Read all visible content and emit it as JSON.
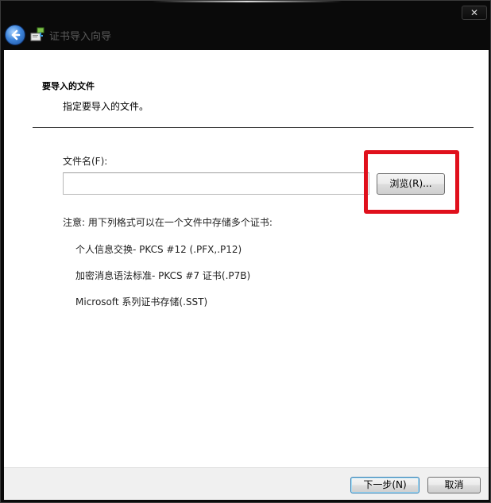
{
  "window": {
    "title": "证书导入向导",
    "close_glyph": "✕"
  },
  "page": {
    "heading": "要导入的文件",
    "subheading": "指定要导入的文件。",
    "file_label": "文件名(F):",
    "file_value": "",
    "browse_label": "浏览(R)...",
    "note": "注意: 用下列格式可以在一个文件中存储多个证书:",
    "formats": [
      "个人信息交换- PKCS #12 (.PFX,.P12)",
      "加密消息语法标准- PKCS #7 证书(.P7B)",
      "Microsoft 系列证书存储(.SST)"
    ]
  },
  "footer": {
    "next_label": "下一步(N)",
    "cancel_label": "取消"
  },
  "colors": {
    "highlight": "#e0101c",
    "titlebar": "#0a0a0a",
    "back_button": "#3f86dc"
  },
  "icons": {
    "back": "back-arrow-icon",
    "app": "certificate-icon",
    "close": "close-icon"
  }
}
